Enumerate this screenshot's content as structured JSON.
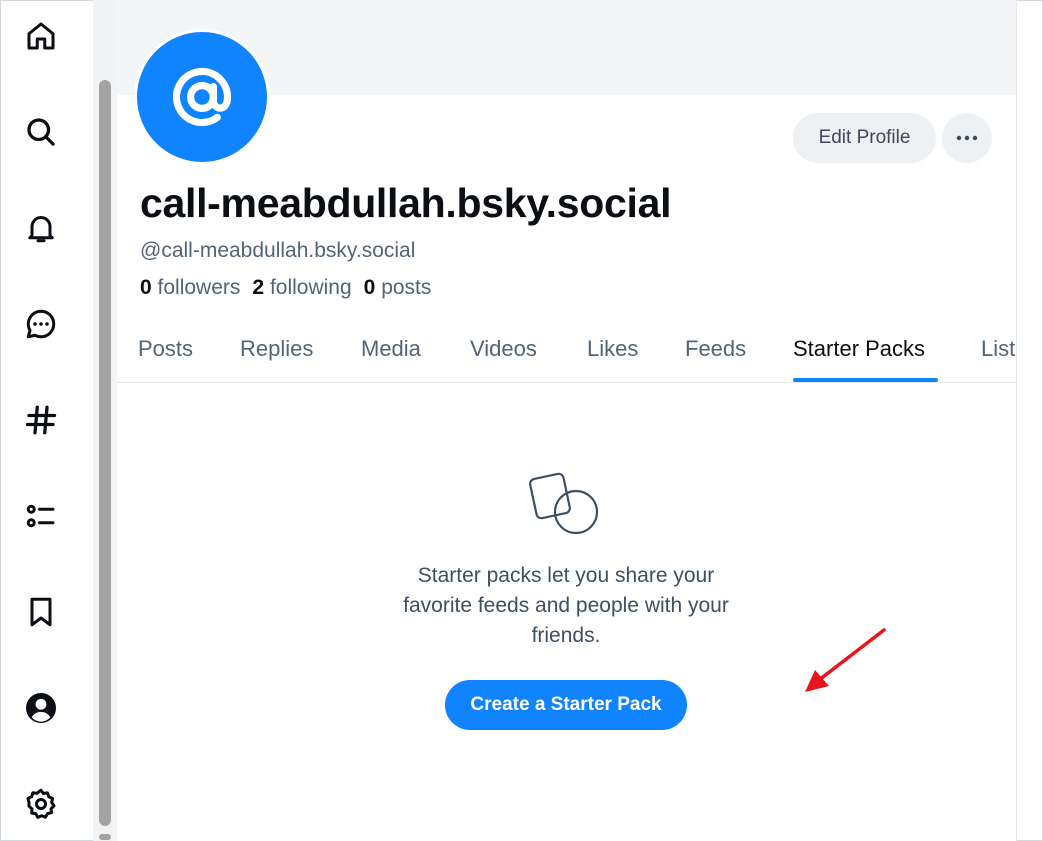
{
  "sidebar": {
    "items": [
      {
        "name": "home",
        "icon": "home-icon"
      },
      {
        "name": "search",
        "icon": "search-icon"
      },
      {
        "name": "notifications",
        "icon": "bell-icon"
      },
      {
        "name": "chat",
        "icon": "chat-icon"
      },
      {
        "name": "feeds",
        "icon": "hashtag-icon"
      },
      {
        "name": "lists",
        "icon": "list-icon"
      },
      {
        "name": "saved",
        "icon": "bookmark-icon"
      },
      {
        "name": "profile",
        "icon": "user-circle-icon"
      },
      {
        "name": "settings",
        "icon": "gear-icon"
      }
    ]
  },
  "profile": {
    "display_name": "call-meabdullah.bsky.social",
    "handle": "@call-meabdullah.bsky.social",
    "followers_count": "0",
    "followers_label": "followers",
    "following_count": "2",
    "following_label": "following",
    "posts_count": "0",
    "posts_label": "posts",
    "edit_label": "Edit Profile",
    "avatar_icon": "at-sign-icon"
  },
  "tabs": [
    {
      "label": "Posts"
    },
    {
      "label": "Replies"
    },
    {
      "label": "Media"
    },
    {
      "label": "Videos"
    },
    {
      "label": "Likes"
    },
    {
      "label": "Feeds"
    },
    {
      "label": "Starter Packs",
      "active": true
    },
    {
      "label": "Lists"
    }
  ],
  "starter_packs": {
    "description": "Starter packs let you share your favorite feeds and people with your friends.",
    "create_label": "Create a Starter Pack"
  },
  "colors": {
    "accent": "#1083fe",
    "annotation_arrow": "#e8161c"
  }
}
